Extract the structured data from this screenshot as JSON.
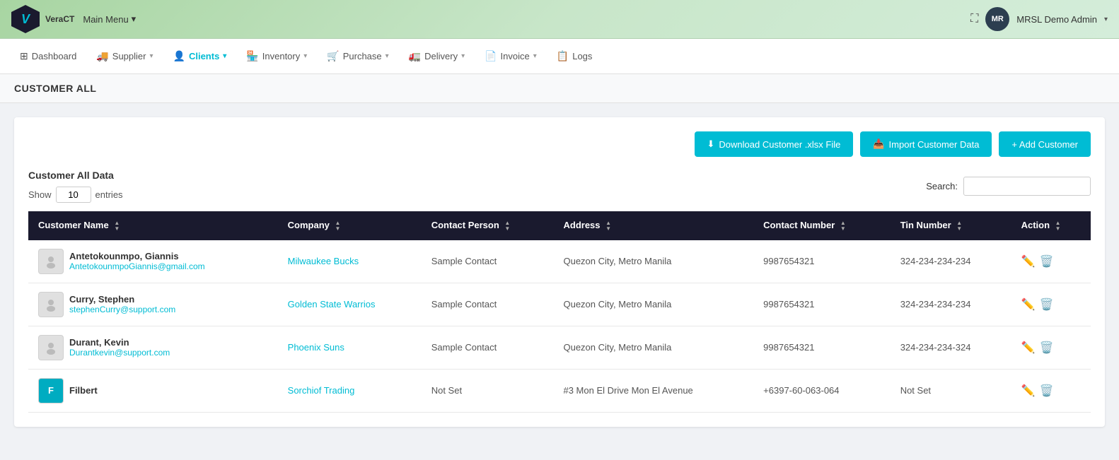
{
  "topbar": {
    "logo_text": "VeraCT",
    "logo_v": "V",
    "main_menu_label": "Main Menu",
    "user_initials": "MR",
    "user_name": "MRSL Demo Admin",
    "fullscreen_icon": "⛶"
  },
  "nav": {
    "items": [
      {
        "id": "dashboard",
        "label": "Dashboard",
        "icon": "⊞",
        "active": false
      },
      {
        "id": "supplier",
        "label": "Supplier",
        "icon": "🚚",
        "active": false,
        "has_dropdown": true
      },
      {
        "id": "clients",
        "label": "Clients",
        "icon": "👤",
        "active": true,
        "has_dropdown": true
      },
      {
        "id": "inventory",
        "label": "Inventory",
        "icon": "🏪",
        "active": false,
        "has_dropdown": true
      },
      {
        "id": "purchase",
        "label": "Purchase",
        "icon": "🛒",
        "active": false,
        "has_dropdown": true
      },
      {
        "id": "delivery",
        "label": "Delivery",
        "icon": "🚛",
        "active": false,
        "has_dropdown": true
      },
      {
        "id": "invoice",
        "label": "Invoice",
        "icon": "📄",
        "active": false,
        "has_dropdown": true
      },
      {
        "id": "logs",
        "label": "Logs",
        "icon": "📋",
        "active": false,
        "has_dropdown": false
      }
    ]
  },
  "page": {
    "title": "CUSTOMER ALL",
    "card_title": "Customer All Data"
  },
  "toolbar": {
    "download_label": "Download Customer .xlsx File",
    "import_label": "Import Customer Data",
    "add_label": "+ Add Customer",
    "download_icon": "⬇",
    "import_icon": "📥"
  },
  "table_controls": {
    "show_label": "Show",
    "entries_value": "10",
    "entries_label": "entries",
    "search_label": "Search:",
    "search_value": ""
  },
  "table": {
    "columns": [
      {
        "id": "customer_name",
        "label": "Customer Name"
      },
      {
        "id": "company",
        "label": "Company"
      },
      {
        "id": "contact_person",
        "label": "Contact Person"
      },
      {
        "id": "address",
        "label": "Address"
      },
      {
        "id": "contact_number",
        "label": "Contact Number"
      },
      {
        "id": "tin_number",
        "label": "Tin Number"
      },
      {
        "id": "action",
        "label": "Action"
      }
    ],
    "rows": [
      {
        "id": 1,
        "name": "Antetokounmpo, Giannis",
        "email": "AntetokounmpoGiannis@gmail.com",
        "company": "Milwaukee Bucks",
        "contact_person": "Sample Contact",
        "address": "Quezon City, Metro Manila",
        "contact_number": "9987654321",
        "tin_number": "324-234-234-234",
        "avatar_type": "image"
      },
      {
        "id": 2,
        "name": "Curry, Stephen",
        "email": "stephenCurry@support.com",
        "company": "Golden State Warrios",
        "contact_person": "Sample Contact",
        "address": "Quezon City, Metro Manila",
        "contact_number": "9987654321",
        "tin_number": "324-234-234-234",
        "avatar_type": "image"
      },
      {
        "id": 3,
        "name": "Durant, Kevin",
        "email": "Durantkevin@support.com",
        "company": "Phoenix Suns",
        "contact_person": "Sample Contact",
        "address": "Quezon City, Metro Manila",
        "contact_number": "9987654321",
        "tin_number": "324-234-234-324",
        "avatar_type": "image"
      },
      {
        "id": 4,
        "name": "Filbert",
        "email": "",
        "company": "Sorchiof Trading",
        "contact_person": "Not Set",
        "address": "#3 Mon El Drive Mon El Avenue",
        "contact_number": "+6397-60-063-064",
        "tin_number": "Not Set",
        "avatar_type": "initials",
        "avatar_initials": "F"
      }
    ]
  }
}
